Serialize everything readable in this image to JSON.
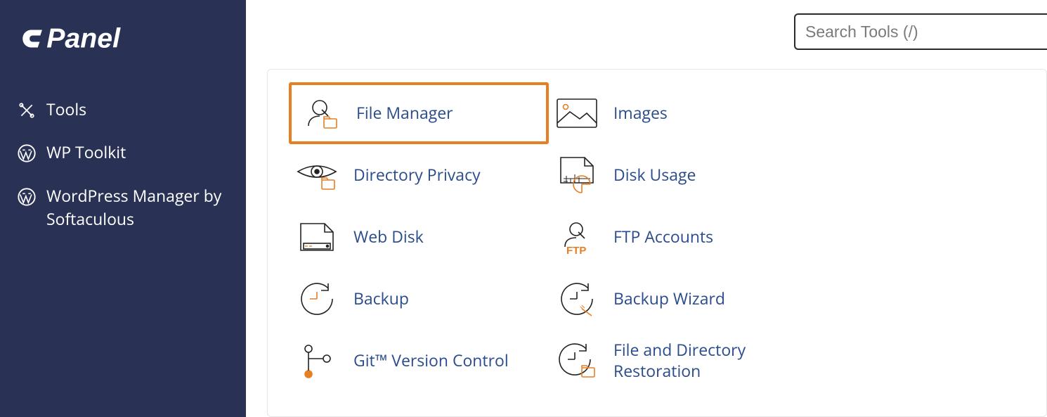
{
  "brand": "cPanel",
  "search": {
    "placeholder": "Search Tools (/)"
  },
  "sidebar": {
    "items": [
      {
        "label": "Tools"
      },
      {
        "label": "WP Toolkit"
      },
      {
        "label": "WordPress Manager by Softaculous"
      }
    ]
  },
  "tools": {
    "col1": [
      {
        "label": "File Manager"
      },
      {
        "label": "Directory Privacy"
      },
      {
        "label": "Web Disk"
      },
      {
        "label": "Backup"
      },
      {
        "label": "Git™ Version Control"
      }
    ],
    "col2": [
      {
        "label": "Images"
      },
      {
        "label": "Disk Usage"
      },
      {
        "label": "FTP Accounts"
      },
      {
        "label": "Backup Wizard"
      },
      {
        "label": "File and Directory Restoration"
      }
    ]
  },
  "colors": {
    "accent": "#e67e22",
    "link": "#2a4c8c",
    "sidebar": "#293254"
  }
}
